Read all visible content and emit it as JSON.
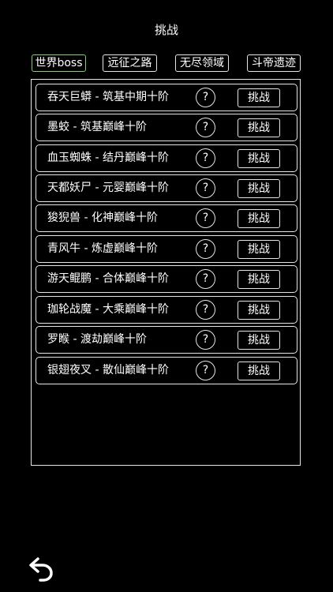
{
  "header": {
    "title": "挑战"
  },
  "tabs": [
    {
      "label": "世界boss",
      "active": true
    },
    {
      "label": "远征之路",
      "active": false
    },
    {
      "label": "无尽领域",
      "active": false
    },
    {
      "label": "斗帝遗迹",
      "active": false
    }
  ],
  "bosses": [
    {
      "name": "吞天巨蟒 - 筑基中期十阶"
    },
    {
      "name": "墨蛟 - 筑基巅峰十阶"
    },
    {
      "name": "血玉蜘蛛 - 结丹巅峰十阶"
    },
    {
      "name": "天都妖尸 - 元婴巅峰十阶"
    },
    {
      "name": "狻猊兽 - 化神巅峰十阶"
    },
    {
      "name": "青风牛 - 炼虚巅峰十阶"
    },
    {
      "name": "游天鲲鹏 - 合体巅峰十阶"
    },
    {
      "name": "珈轮战魔 - 大乘巅峰十阶"
    },
    {
      "name": "罗睺 - 渡劫巅峰十阶"
    },
    {
      "name": "银翅夜叉 - 散仙巅峰十阶"
    }
  ],
  "row": {
    "help_symbol": "?",
    "challenge_label": "挑战"
  },
  "colors": {
    "background": "#000000",
    "border": "#e6e6e6",
    "active_tab_border": "#7fd36b",
    "text": "#ffffff"
  },
  "icons": {
    "help": "question-circle-icon",
    "back": "back-arrow-icon"
  }
}
